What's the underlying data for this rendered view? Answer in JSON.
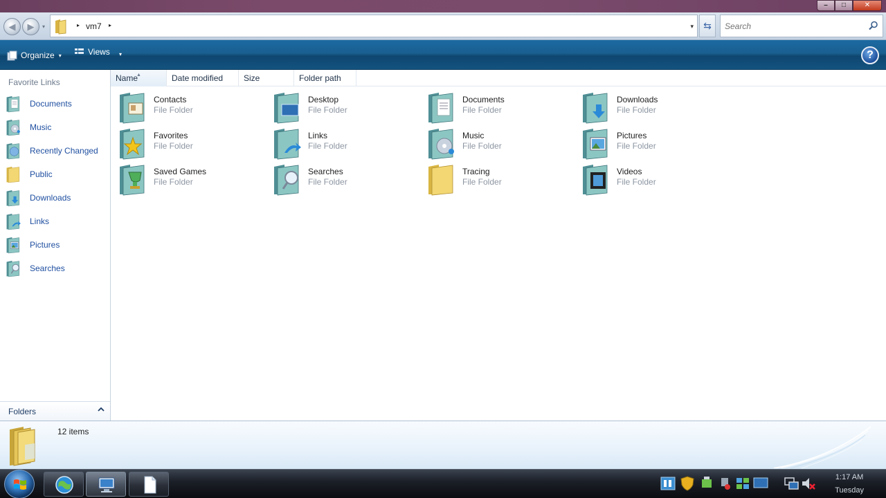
{
  "window": {
    "minimize_glyph": "–",
    "maximize_glyph": "□",
    "close_glyph": "✕"
  },
  "address": {
    "crumb": "vm7",
    "separator": "▸",
    "dropdown_glyph": "▾"
  },
  "search": {
    "placeholder": "Search"
  },
  "toolbar": {
    "organize_label": "Organize",
    "views_label": "Views",
    "caret": "▾",
    "help_glyph": "?"
  },
  "nav": {
    "heading": "Favorite Links",
    "items": [
      {
        "label": "Documents",
        "icon": "documents-folder-icon"
      },
      {
        "label": "Music",
        "icon": "music-folder-icon"
      },
      {
        "label": "Recently Changed",
        "icon": "recently-changed-icon"
      },
      {
        "label": "Public",
        "icon": "public-folder-icon"
      },
      {
        "label": "Downloads",
        "icon": "downloads-folder-icon"
      },
      {
        "label": "Links",
        "icon": "links-folder-icon"
      },
      {
        "label": "Pictures",
        "icon": "pictures-folder-icon"
      },
      {
        "label": "Searches",
        "icon": "searches-folder-icon"
      }
    ],
    "folders_label": "Folders"
  },
  "columns": {
    "name": "Name",
    "date_modified": "Date modified",
    "size": "Size",
    "folder_path": "Folder path",
    "sort_glyph": "▲"
  },
  "files": [
    {
      "name": "Contacts",
      "type": "File Folder",
      "icon": "contacts-folder-icon"
    },
    {
      "name": "Desktop",
      "type": "File Folder",
      "icon": "desktop-folder-icon"
    },
    {
      "name": "Documents",
      "type": "File Folder",
      "icon": "documents-folder-icon"
    },
    {
      "name": "Downloads",
      "type": "File Folder",
      "icon": "downloads-folder-icon"
    },
    {
      "name": "Favorites",
      "type": "File Folder",
      "icon": "favorites-folder-icon"
    },
    {
      "name": "Links",
      "type": "File Folder",
      "icon": "links-folder-icon"
    },
    {
      "name": "Music",
      "type": "File Folder",
      "icon": "music-folder-icon"
    },
    {
      "name": "Pictures",
      "type": "File Folder",
      "icon": "pictures-folder-icon"
    },
    {
      "name": "Saved Games",
      "type": "File Folder",
      "icon": "saved-games-folder-icon"
    },
    {
      "name": "Searches",
      "type": "File Folder",
      "icon": "searches-folder-icon"
    },
    {
      "name": "Tracing",
      "type": "File Folder",
      "icon": "plain-folder-icon"
    },
    {
      "name": "Videos",
      "type": "File Folder",
      "icon": "videos-folder-icon"
    }
  ],
  "details": {
    "item_count": "12 items"
  },
  "taskbar": {
    "time": "1:17 AM",
    "day": "Tuesday"
  },
  "colors": {
    "link_blue": "#1f4fa0",
    "toolbar_blue": "#1a5f8f",
    "folder_teal": "#5fa3a3",
    "folder_yellow": "#e9c95a",
    "muted_text": "#8d96a2"
  }
}
